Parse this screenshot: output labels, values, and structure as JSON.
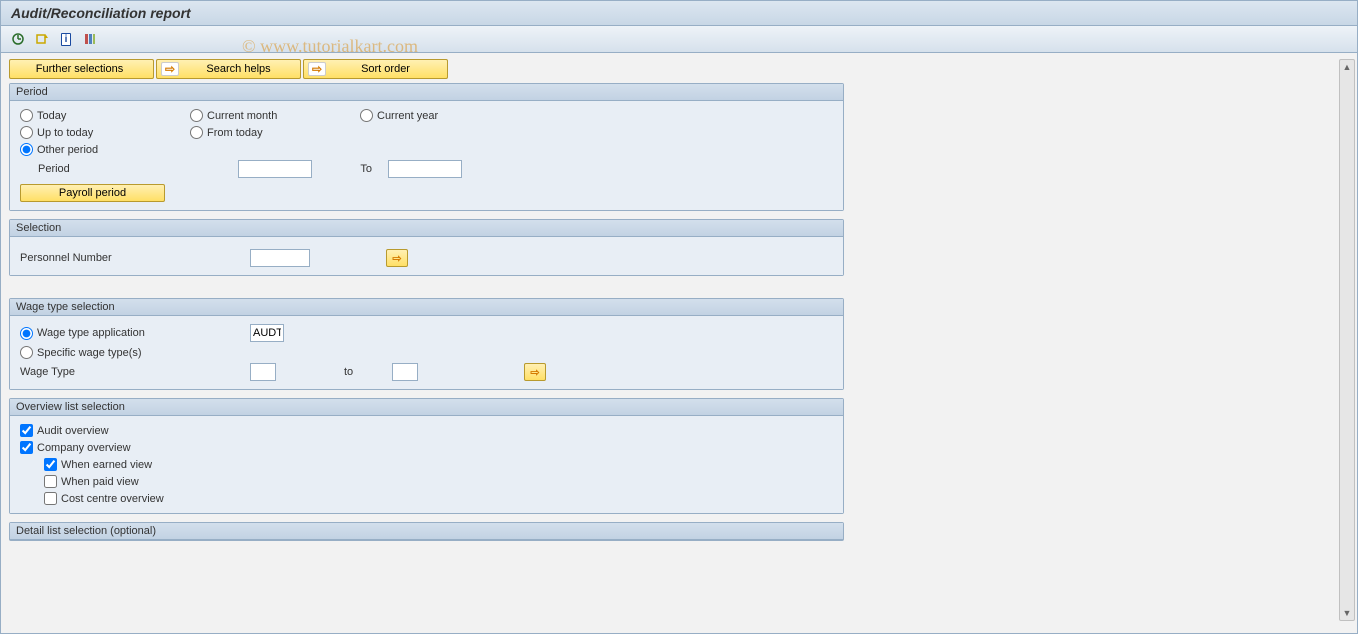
{
  "title": "Audit/Reconciliation report",
  "watermark": "© www.tutorialkart.com",
  "buttons": {
    "further_selections": "Further selections",
    "search_helps": "Search helps",
    "sort_order": "Sort order",
    "payroll_period": "Payroll period"
  },
  "groups": {
    "period": {
      "title": "Period",
      "options": {
        "today": "Today",
        "current_month": "Current month",
        "current_year": "Current year",
        "up_to_today": "Up to today",
        "from_today": "From today",
        "other_period": "Other period"
      },
      "period_label": "Period",
      "to_label": "To",
      "period_from": "",
      "period_to": ""
    },
    "selection": {
      "title": "Selection",
      "personnel_label": "Personnel Number",
      "personnel_value": ""
    },
    "wage": {
      "title": "Wage type selection",
      "opt_app": "Wage type application",
      "app_value": "AUDT",
      "opt_specific": "Specific wage type(s)",
      "wage_type_label": "Wage Type",
      "to_label": "to",
      "from_value": "",
      "to_value": ""
    },
    "overview": {
      "title": "Overview list selection",
      "audit": "Audit overview",
      "company": "Company overview",
      "when_earned": "When earned view",
      "when_paid": "When paid view",
      "cost_centre": "Cost centre overview"
    },
    "detail": {
      "title": "Detail list selection (optional)"
    }
  }
}
